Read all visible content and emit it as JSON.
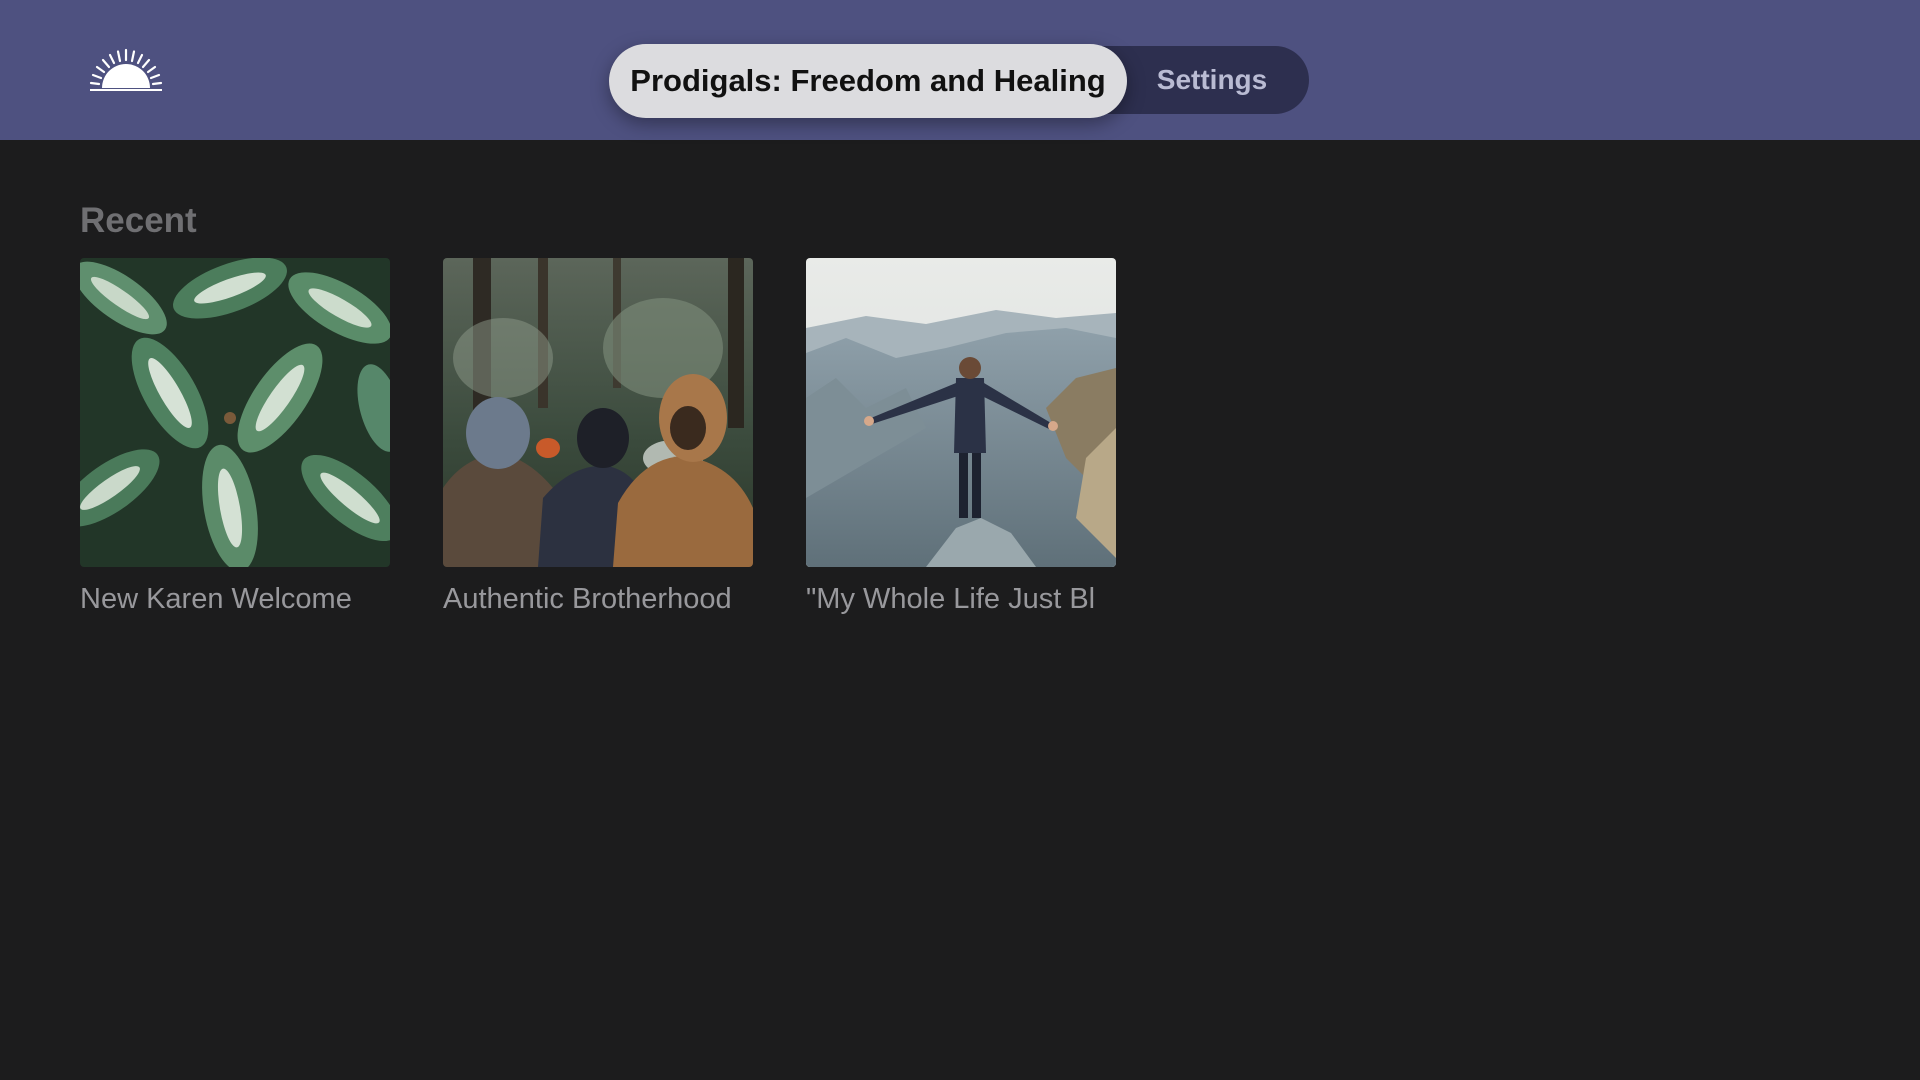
{
  "header": {
    "logo_icon": "sunrise-icon",
    "tabs": [
      {
        "label": "Prodigals: Freedom and Healing",
        "active": true
      },
      {
        "label": "Settings",
        "active": false
      }
    ]
  },
  "main": {
    "section_title": "Recent",
    "items": [
      {
        "title": "New Karen Welcome",
        "thumbnail": "green-leaves-photo"
      },
      {
        "title": "Authentic Brotherhood",
        "thumbnail": "hooded-men-forest-photo"
      },
      {
        "title": "\"My Whole Life Just Bl",
        "thumbnail": "man-mountain-arms-outstretched-photo"
      }
    ]
  },
  "colors": {
    "header_bg": "#4e5180",
    "page_bg": "#1c1c1d",
    "tab_active_bg": "#dcdcdf",
    "tab_bar_bg": "#2d2f4f"
  }
}
